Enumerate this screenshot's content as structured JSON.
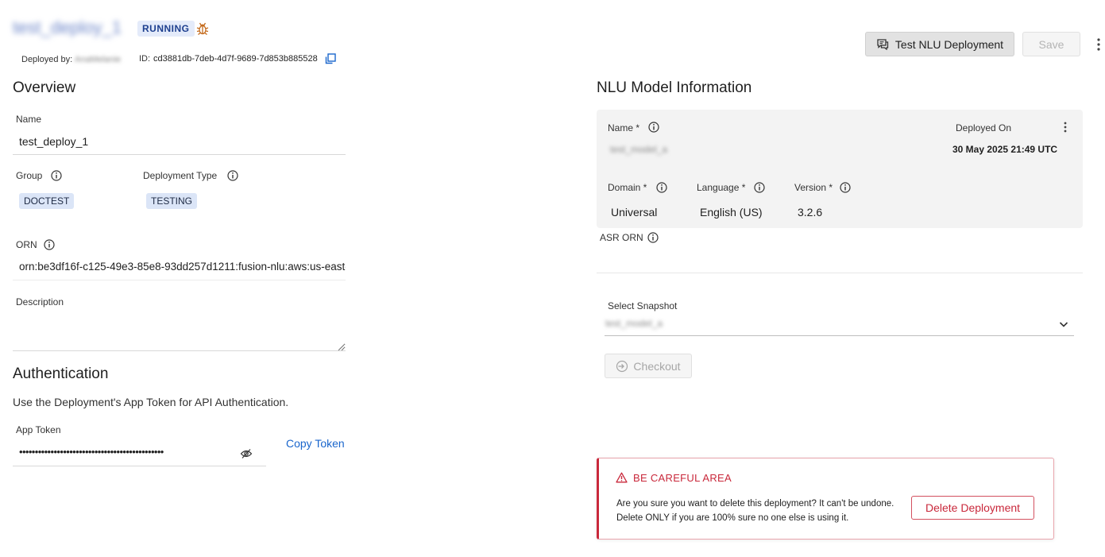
{
  "header": {
    "deployment_name": "test_deploy_1",
    "status": "RUNNING",
    "deployed_by_label": "Deployed by:",
    "deployed_by_value": "AnaMelanie",
    "id_label": "ID:",
    "id_value": "cd3881db-7deb-4d7f-9689-7d853b885528",
    "test_button_label": "Test NLU Deployment",
    "save_button_label": "Save"
  },
  "overview": {
    "heading": "Overview",
    "name_label": "Name",
    "name_value": "test_deploy_1",
    "group_label": "Group",
    "group_value": "DOCTEST",
    "deployment_type_label": "Deployment Type",
    "deployment_type_value": "TESTING",
    "orn_label": "ORN",
    "orn_value": "orn:be3df16f-c125-49e3-85e8-93dd257d1211:fusion-nlu:aws:us-east-",
    "description_label": "Description",
    "description_value": ""
  },
  "authentication": {
    "heading": "Authentication",
    "description": "Use the Deployment's App Token for API Authentication.",
    "app_token_label": "App Token",
    "app_token_masked": "••••••••••••••••••••••••••••••••••••••••••••••",
    "copy_token_label": "Copy Token"
  },
  "nlu_model": {
    "heading": "NLU Model Information",
    "name_label": "Name *",
    "name_value": "test_model_a",
    "deployed_on_label": "Deployed On",
    "deployed_on_value": "30 May 2025 21:49 UTC",
    "domain_label": "Domain *",
    "domain_value": "Universal",
    "language_label": "Language *",
    "language_value": "English (US)",
    "version_label": "Version *",
    "version_value": "3.2.6",
    "asr_orn_label": "ASR ORN",
    "select_snapshot_label": "Select Snapshot",
    "select_snapshot_value": "test_model_a",
    "checkout_button_label": "Checkout"
  },
  "danger_zone": {
    "title": "BE CAREFUL AREA",
    "message": "Are you sure you want to delete this deployment? It can't be undone. Delete ONLY if you are 100% sure no one else is using it.",
    "delete_button_label": "Delete Deployment"
  },
  "colors": {
    "accent_blue": "#1a66cc",
    "status_pill_bg": "#e4ebfa",
    "tag_bg": "#dbe5f7",
    "danger_red": "#c9283b",
    "card_bg": "#f3f3f3"
  },
  "icons": {
    "bug": "bug-icon",
    "copy": "copy-icon",
    "chat": "chat-icon",
    "kebab": "more-vertical-icon",
    "info": "info-icon",
    "eye_off": "eye-off-icon",
    "chevron": "chevron-down-icon",
    "checkout": "login-arrow-icon",
    "warning": "warning-icon"
  }
}
